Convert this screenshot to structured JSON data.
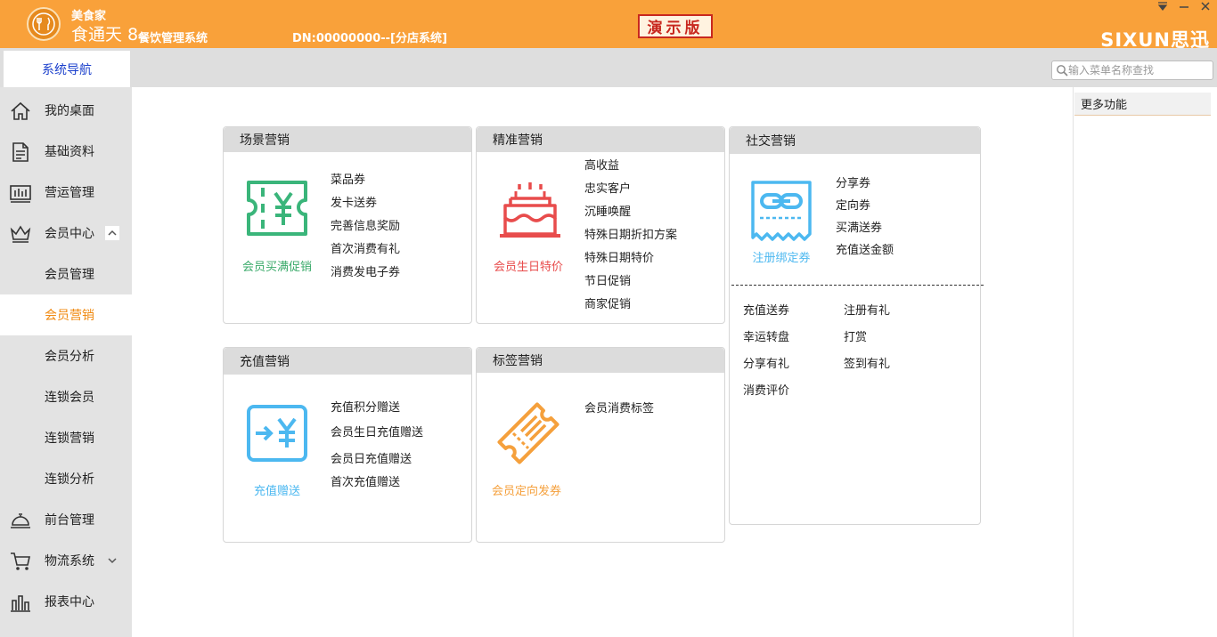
{
  "titlebar": {
    "brand_small": "美食家",
    "brand_main": "食通天 8",
    "brand_sys": "餐饮管理系统",
    "dn": "DN:00000000--[分店系统]",
    "demo": "演示版",
    "vendor_logo": "SIXUN思迅",
    "colors": {
      "bar": "#f9a13a",
      "demo_border": "#c8281f"
    }
  },
  "nav": {
    "tab_label": "系统导航",
    "search_placeholder": "输入菜单名称查找"
  },
  "sidebar": {
    "items": [
      {
        "label": "我的桌面",
        "icon": "home-icon"
      },
      {
        "label": "基础资料",
        "icon": "document-icon"
      },
      {
        "label": "营运管理",
        "icon": "chart-icon"
      },
      {
        "label": "会员中心",
        "icon": "crown-icon",
        "expanded": true
      },
      {
        "label": "会员管理"
      },
      {
        "label": "会员营销",
        "active": true
      },
      {
        "label": "会员分析"
      },
      {
        "label": "连锁会员"
      },
      {
        "label": "连锁营销"
      },
      {
        "label": "连锁分析"
      },
      {
        "label": "前台管理",
        "icon": "cloche-icon"
      },
      {
        "label": "物流系统",
        "icon": "cart-icon",
        "expanded": false
      },
      {
        "label": "报表中心",
        "icon": "bars-icon"
      }
    ],
    "active_color": "#f08a12"
  },
  "cards": {
    "scene": {
      "title": "场景营销",
      "caption": "会员买满促销",
      "caption_color": "#3aaa6a",
      "links": [
        "菜品券",
        "发卡送券",
        "完善信息奖励",
        "首次消费有礼",
        "消费发电子券"
      ]
    },
    "precise": {
      "title": "精准营销",
      "caption": "会员生日特价",
      "caption_color": "#e84c4c",
      "links": [
        "高收益",
        "忠实客户",
        "沉睡唤醒",
        "特殊日期折扣方案",
        "特殊日期特价",
        "节日促销",
        "商家促销"
      ]
    },
    "social": {
      "title": "社交营销",
      "caption": "注册绑定券",
      "caption_color": "#4cb8f0",
      "links": [
        "分享券",
        "定向券",
        "买满送券",
        "充值送金额"
      ],
      "extra_left": [
        "充值送券",
        "幸运转盘",
        "分享有礼",
        "消费评价"
      ],
      "extra_right": [
        "注册有礼",
        "打赏",
        "签到有礼"
      ]
    },
    "recharge": {
      "title": "充值营销",
      "caption": "充值赠送",
      "caption_color": "#4cb8f0",
      "links": [
        "充值积分赠送",
        "会员生日充值赠送",
        "会员日充值赠送",
        "首次充值赠送"
      ]
    },
    "tag": {
      "title": "标签营销",
      "caption": "会员定向发券",
      "caption_color": "#f5a03c",
      "links": [
        "会员消费标签"
      ]
    }
  },
  "right_panel": {
    "title": "更多功能"
  }
}
